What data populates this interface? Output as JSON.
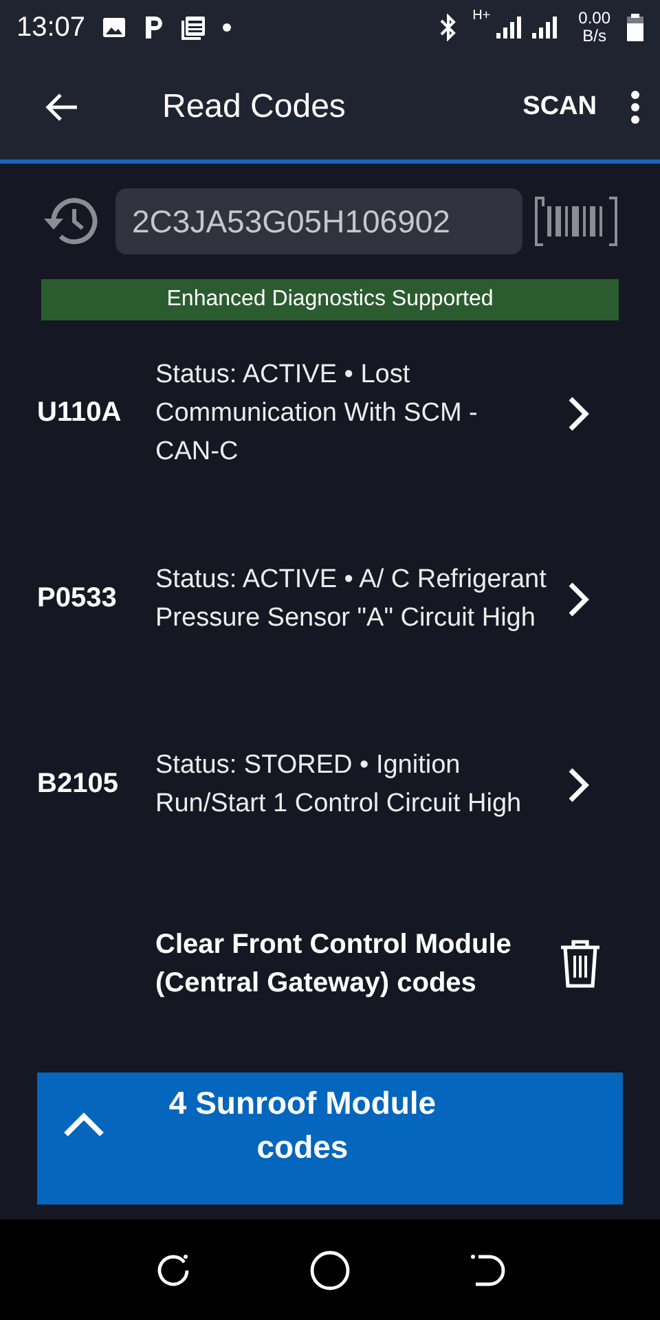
{
  "status_bar": {
    "time": "13:07",
    "network_type": "H+",
    "speed_value": "0.00",
    "speed_unit": "B/s"
  },
  "toolbar": {
    "title": "Read Codes",
    "action": "SCAN"
  },
  "vin_field": {
    "value": "2C3JA53G05H106902"
  },
  "banner": "Enhanced Diagnostics Supported",
  "codes": [
    {
      "code": "U110A",
      "description": "Status: ACTIVE • Lost Communication With SCM - CAN-C"
    },
    {
      "code": "P0533",
      "description": "Status: ACTIVE • A/ C Refrigerant Pressure Sensor \"A\" Circuit High"
    },
    {
      "code": "B2105",
      "description": "Status: STORED • Ignition Run/Start 1 Control Circuit High"
    }
  ],
  "clear_action": "Clear Front Control Module (Central Gateway) codes",
  "module_panel": {
    "title": "4 Sunroof Module codes",
    "expanded": false
  }
}
